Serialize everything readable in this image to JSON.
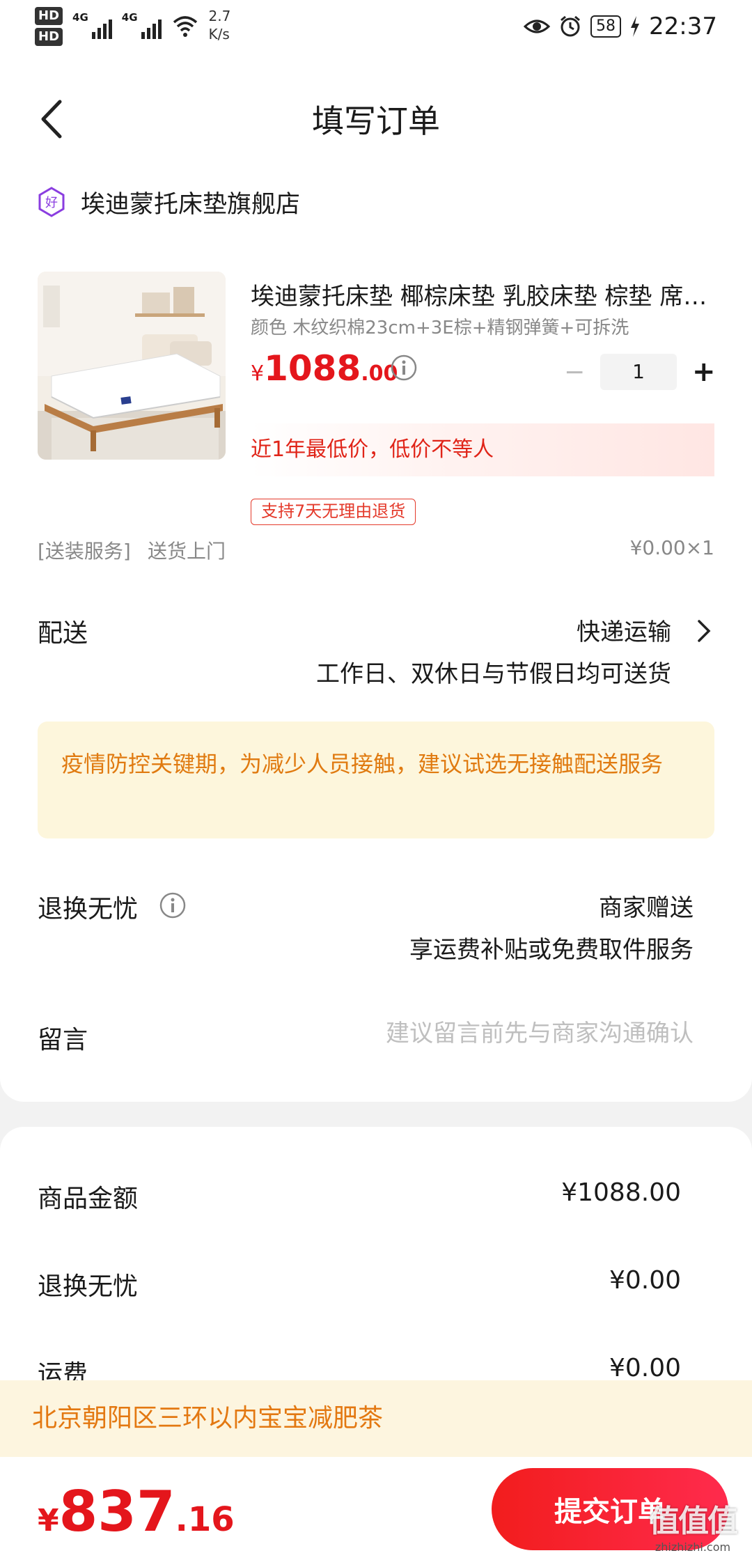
{
  "status_bar": {
    "hd1": "HD",
    "hd2": "HD",
    "net1": "4G",
    "net2": "4G",
    "speed_value": "2.7",
    "speed_unit": "K/s",
    "battery": "58",
    "time": "22:37"
  },
  "header": {
    "title": "填写订单"
  },
  "shop": {
    "name": "埃迪蒙托床垫旗舰店",
    "icon_text": "好"
  },
  "product": {
    "title": "埃迪蒙托床垫 椰棕床垫 乳胶床垫 棕垫 席梦思床垫",
    "spec": "颜色 木纹织棉23cm+3E棕+精钢弹簧+可拆洗",
    "price_currency": "¥",
    "price_int": "1088",
    "price_dec": ".00",
    "quantity": "1",
    "minus_label": "−",
    "plus_label": "+",
    "lowest_price_note": "近1年最低价，低价不等人",
    "return_tag": "支持7天无理由退货"
  },
  "service": {
    "label": "[送装服务]",
    "value": "送货上门",
    "price": "¥0.00×1"
  },
  "delivery": {
    "label": "配送",
    "method": "快递运输",
    "note": "工作日、双休日与节假日均可送货"
  },
  "notice": {
    "text": "疫情防控关键期，为减少人员接触，建议试选无接触配送服务"
  },
  "return_worry": {
    "label": "退换无忧",
    "value": "商家赠送",
    "note": "享运费补贴或免费取件服务"
  },
  "message": {
    "label": "留言",
    "placeholder": "建议留言前先与商家沟通确认"
  },
  "summary": {
    "rows": [
      {
        "label": "商品金额",
        "value": "¥1088.00"
      },
      {
        "label": "退换无忧",
        "value": "¥0.00"
      },
      {
        "label": "运费",
        "value": "¥0.00"
      }
    ]
  },
  "address": {
    "text": "北京朝阳区三环以内宝宝减肥茶"
  },
  "footer": {
    "total_currency": "¥",
    "total_int": "837",
    "total_dec": ".16",
    "submit_label": "提交订单"
  },
  "watermark": {
    "big": "值值值",
    "small": "zhizhizhi.com"
  },
  "colors": {
    "accent_red": "#e4161c",
    "notice_orange": "#e07a10",
    "notice_bg": "#fdf6dc"
  }
}
